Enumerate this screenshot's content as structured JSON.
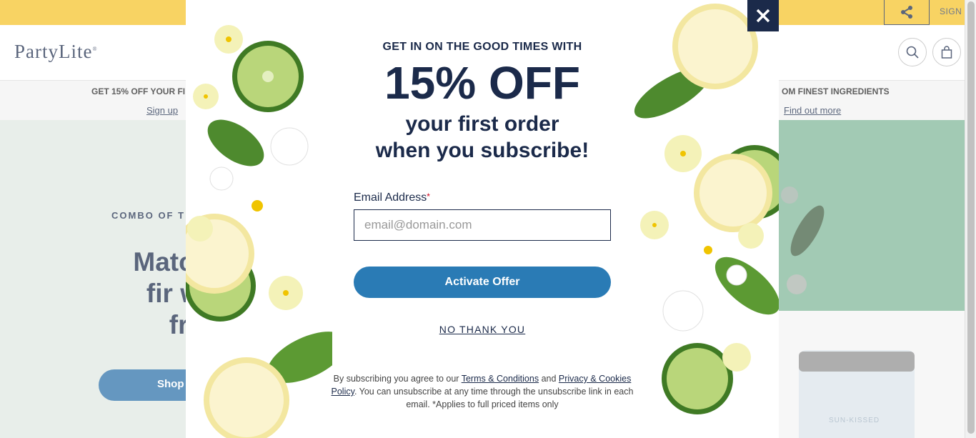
{
  "topbar": {
    "share_icon": "share-icon",
    "sign_in": "SIGN"
  },
  "header": {
    "logo": "PartyLite",
    "logo_mark": "®",
    "search_icon": "search-icon",
    "bag_icon": "shopping-bag-icon"
  },
  "promo": {
    "left_text": "GET 15% OFF YOUR FI",
    "left_link": "Sign up",
    "right_text": "OM FINEST INGREDIENTS",
    "right_link": "Find out more"
  },
  "hero": {
    "eyebrow": "COMBO OF T",
    "title_line1": "Match wint",
    "title_line2": "fir with p",
    "title_line3": "fresh",
    "shop_button": "Shop",
    "product_text": "SUN-KISSED"
  },
  "modal": {
    "eyebrow": "GET IN ON THE GOOD TIMES WITH",
    "headline": "15% OFF",
    "sub_line1": "your first order",
    "sub_line2": "when you subscribe!",
    "email_label": "Email Address",
    "required_mark": "*",
    "email_placeholder": "email@domain.com",
    "activate_button": "Activate Offer",
    "no_thanks": "NO THANK YOU",
    "legal_prefix": "By subscribing you agree to our",
    "legal_terms": "Terms & Conditions",
    "legal_and": "and",
    "legal_privacy": "Privacy & Cookies Policy",
    "legal_suffix": ". You can unsubscribe at any time through the unsubscribe link in each email. *Applies to full priced items only",
    "close_icon": "close-icon"
  },
  "colors": {
    "navy": "#1b2a4a",
    "yellow": "#f6c327",
    "blue": "#2a7bb5",
    "green": "#7fb697"
  }
}
